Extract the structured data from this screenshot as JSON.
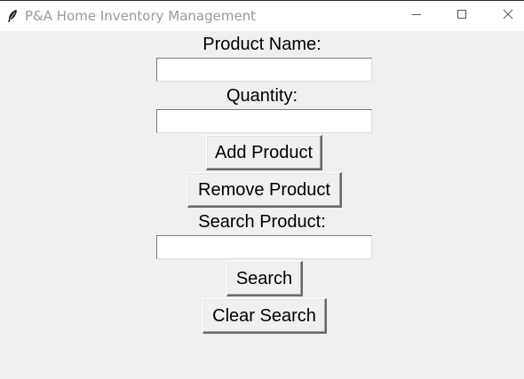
{
  "window": {
    "title": "P&A Home Inventory Management",
    "app_icon": "feather-icon",
    "controls": {
      "minimize_icon": "minimize-icon",
      "maximize_icon": "maximize-icon",
      "close_icon": "close-icon"
    }
  },
  "form": {
    "product_name_label": "Product Name:",
    "product_name_value": "",
    "quantity_label": "Quantity:",
    "quantity_value": "",
    "add_button_label": "Add Product",
    "remove_button_label": "Remove Product",
    "search_label": "Search Product:",
    "search_value": "",
    "search_button_label": "Search",
    "clear_search_button_label": "Clear Search"
  },
  "colors": {
    "background": "#f0f0f0",
    "titlebar": "#ffffff",
    "title_text": "#9a9a9a"
  }
}
